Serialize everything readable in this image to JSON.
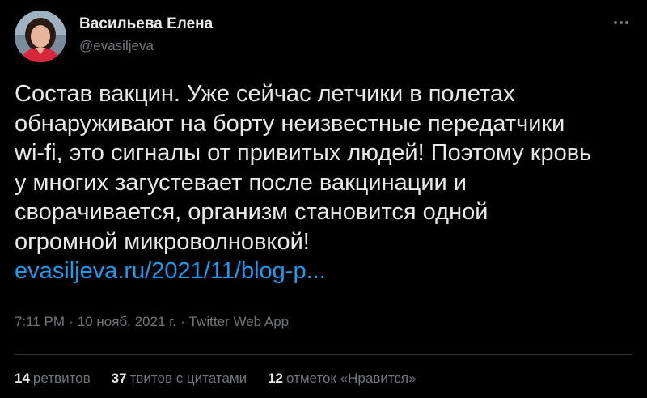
{
  "author": {
    "display_name": "Васильева Елена",
    "handle": "@evasiljeva",
    "avatar_icon": "user-avatar"
  },
  "menu": {
    "icon": "more-horizontal-icon"
  },
  "tweet": {
    "lines": [
      "Состав вакцин. Уже сейчас летчики в полетах",
      "обнаруживают на борту неизвестные передатчики",
      "wi-fi, это сигналы от привитых людей! Поэтому кровь",
      "у многих загустевает после вакцинации и",
      "сворачивается, организм становится одной",
      "огромной микроволновкой!"
    ],
    "link": "evasiljeva.ru/2021/11/blog-p..."
  },
  "meta": {
    "time": "7:11 PM",
    "separator": "·",
    "date": "10 нояб. 2021 г.",
    "app": "Twitter Web App"
  },
  "stats": {
    "retweets": {
      "count": "14",
      "label": "ретвитов"
    },
    "quotes": {
      "count": "37",
      "label": "твитов с цитатами"
    },
    "likes": {
      "count": "12",
      "label": "отметок «Нравится»"
    }
  },
  "colors": {
    "background": "#000000",
    "text": "#e7e9ea",
    "secondary": "#71767b",
    "link": "#1d9bf0",
    "divider": "#2f3336"
  }
}
